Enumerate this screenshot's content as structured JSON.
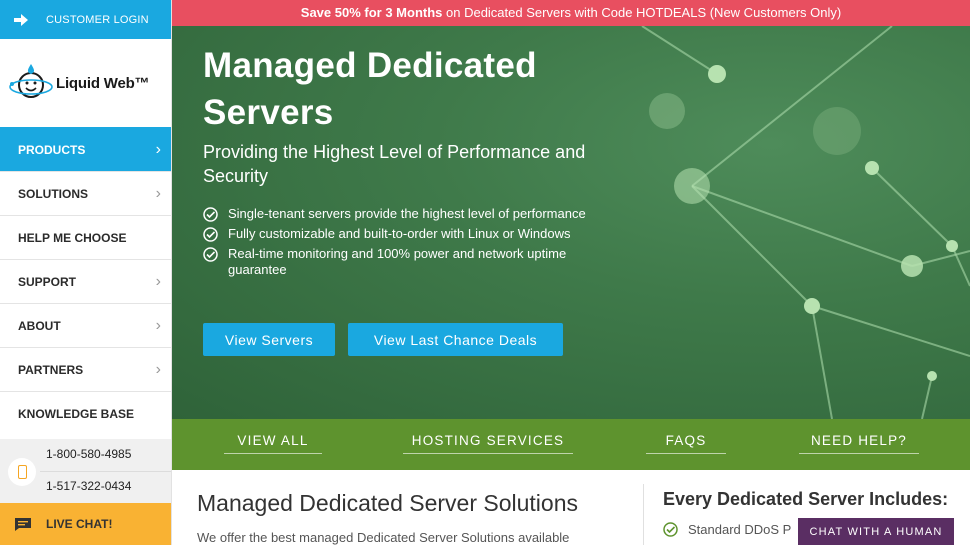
{
  "sidebar": {
    "login_label": "CUSTOMER LOGIN",
    "logo_text": "Liquid Web™",
    "nav": [
      {
        "label": "PRODUCTS",
        "icon": "chevron-right-icon"
      },
      {
        "label": "SOLUTIONS",
        "icon": "chevron-right-icon"
      },
      {
        "label": "HELP ME CHOOSE",
        "icon": ""
      },
      {
        "label": "SUPPORT",
        "icon": "chevron-right-icon"
      },
      {
        "label": "ABOUT",
        "icon": "chevron-right-icon"
      },
      {
        "label": "PARTNERS",
        "icon": "chevron-right-icon"
      },
      {
        "label": "KNOWLEDGE BASE",
        "icon": ""
      }
    ],
    "phones": [
      "1-800-580-4985",
      "1-517-322-0434"
    ],
    "live_chat": "LIVE CHAT!"
  },
  "promo": {
    "bold": "Save 50% for 3 Months",
    "rest": " on Dedicated Servers with Code HOTDEALS (New Customers Only)"
  },
  "hero": {
    "title": "Managed Dedicated Servers",
    "subtitle": "Providing the Highest Level of Performance and Security",
    "bullets": [
      "Single-tenant servers provide the highest level of performance",
      "Fully customizable and built-to-order with Linux or Windows",
      "Real-time monitoring and 100% power and network uptime guarantee"
    ],
    "btn_primary": "View Servers",
    "btn_secondary": "View Last Chance Deals"
  },
  "subnav": [
    "VIEW ALL",
    "HOSTING SERVICES",
    "FAQS",
    "NEED HELP?"
  ],
  "content": {
    "left_title": "Managed Dedicated Server Solutions",
    "left_text": "We offer the best managed Dedicated Server Solutions available",
    "right_title": "Every Dedicated Server Includes:",
    "right_feature": "Standard DDoS P",
    "chat_human": "CHAT WITH A HUMAN"
  },
  "colors": {
    "brand_blue": "#1aa8e0",
    "promo_red": "#e84f60",
    "subnav_green": "#5e932e",
    "chat_orange": "#f9b233",
    "chat_purple": "#5a2e63"
  }
}
